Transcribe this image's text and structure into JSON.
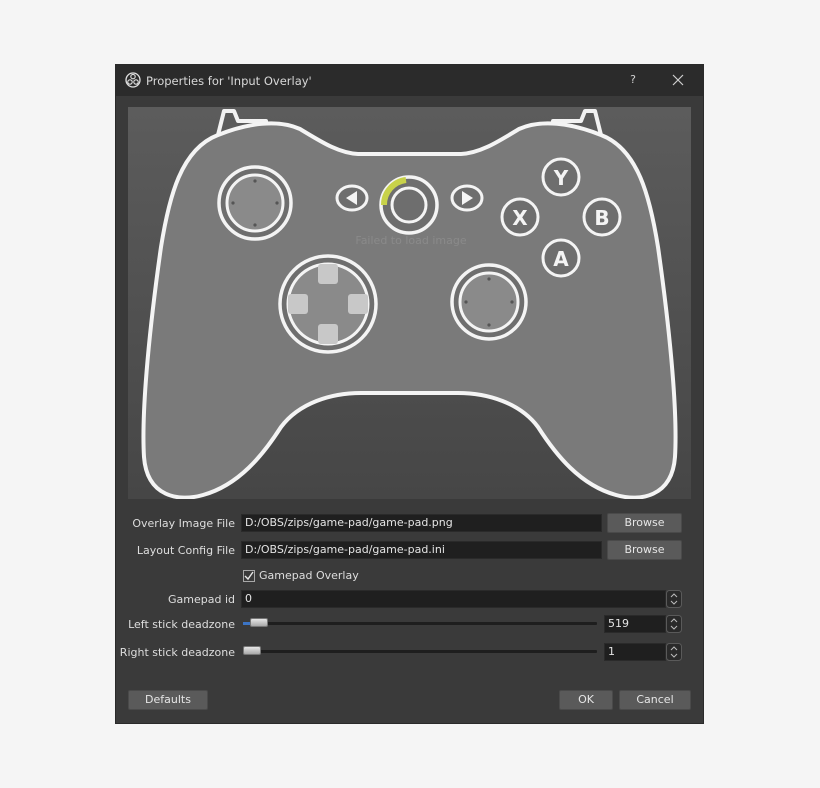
{
  "window": {
    "title": "Properties for 'Input Overlay'",
    "help_label": "?",
    "icons": {
      "app": "obs-logo-icon",
      "close": "close-icon"
    }
  },
  "preview": {
    "overlay_text": "Failed to load image",
    "buttons": {
      "y": "Y",
      "x": "X",
      "b": "B",
      "a": "A"
    }
  },
  "form": {
    "overlay_image": {
      "label": "Overlay Image File",
      "value": "D:/OBS/zips/game-pad/game-pad.png",
      "button": "Browse"
    },
    "layout_config": {
      "label": "Layout Config File",
      "value": "D:/OBS/zips/game-pad/game-pad.ini",
      "button": "Browse"
    },
    "gamepad_overlay": {
      "label": "Gamepad Overlay",
      "checked": true
    },
    "gamepad_id": {
      "label": "Gamepad id",
      "value": "0"
    },
    "left_deadzone": {
      "label": "Left stick deadzone",
      "value": "519",
      "fraction": 0.02
    },
    "right_deadzone": {
      "label": "Right stick deadzone",
      "value": "1",
      "fraction": 0.0
    }
  },
  "footer": {
    "defaults": "Defaults",
    "ok": "OK",
    "cancel": "Cancel"
  },
  "colors": {
    "window_bg": "#3a3a3a",
    "titlebar_bg": "#2b2b2b",
    "field_bg": "#1f1f1f",
    "button_bg": "#5a5a5a",
    "accent": "#3c74c4",
    "trigger_highlight": "#c8d24a"
  }
}
